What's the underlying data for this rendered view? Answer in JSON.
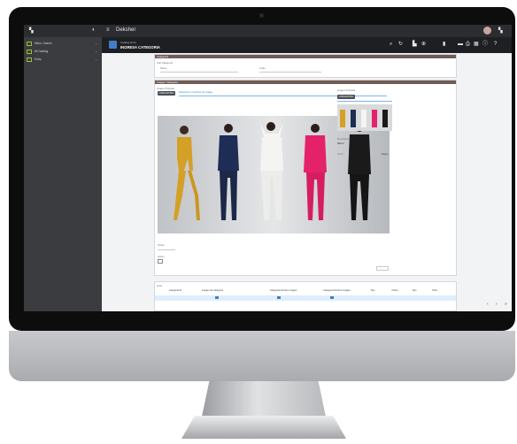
{
  "app": {
    "title": "Deksher",
    "logo_label": "DE",
    "user_initials": "AK"
  },
  "header": {
    "breadcrumb_top": "Catalog Entry",
    "page_title": "INGRESA CATEGORIA"
  },
  "sidebar": {
    "items": [
      {
        "label": "Menu / Admin"
      },
      {
        "label": "Mi Catalog"
      },
      {
        "label": "Entry"
      }
    ]
  },
  "toolbar": {
    "icons": [
      "search-icon",
      "refresh-icon",
      "file-icon",
      "add-icon",
      "trash-icon",
      "card-icon",
      "print-icon",
      "grid-icon",
      "info-icon",
      "help-icon"
    ]
  },
  "categoria_panel": {
    "title": "Categoria",
    "field_label": "Sub Categoria",
    "field_a_label": "Name",
    "field_b_label": "Code"
  },
  "images_panel": {
    "title": "Imagen Categoria",
    "left_label": "Imagen Portada",
    "right_label": "Imagen Portada",
    "upload_button": "CARGAR IMG",
    "upload_button_right": "CARGAR IMG",
    "file_hint": "Seleccione un archivo de imagen",
    "field_1_label": "Orden",
    "field_2_label": "Activo",
    "right_field_label": "Descripcion",
    "right_field_value": "Blazer",
    "right_small_label": "Color",
    "right_small_value": "Negro"
  },
  "table": {
    "title": "Lista",
    "columns": [
      "Categoria ID",
      "Imagen de Categoria",
      "Categoria Nombre Imagen",
      "Categoria Nombre Imagen",
      "Tipo",
      "Orden",
      "Tipo",
      "Color"
    ],
    "row": [
      "",
      "",
      "",
      "",
      "",
      "",
      "",
      ""
    ]
  },
  "colors": {
    "accent_bar": "#6f5b58",
    "link_blue": "#2f7fd8",
    "sidebar_bg": "#3a3c3f",
    "topbar_bg": "#2b2d30",
    "header_bg": "#1d1f22"
  }
}
